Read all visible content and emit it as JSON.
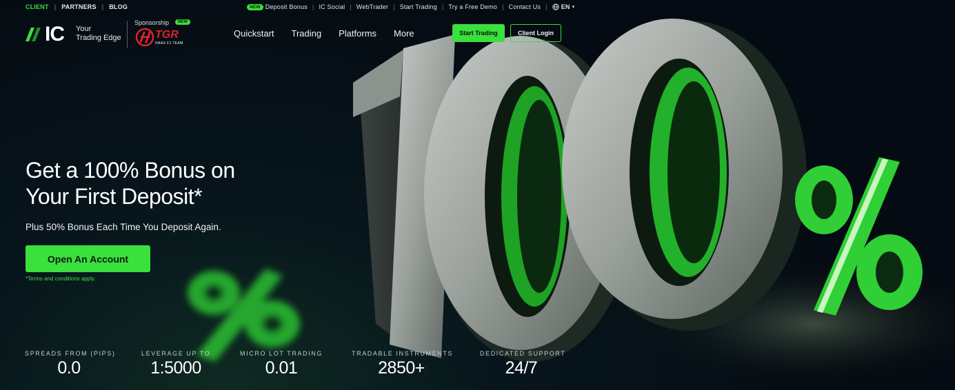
{
  "topbar": {
    "left_links": [
      {
        "label": "CLIENT",
        "active": true
      },
      {
        "label": "PARTNERS",
        "active": false
      },
      {
        "label": "BLOG",
        "active": false
      }
    ],
    "right_badge": "NEW",
    "right_links": [
      "Deposit Bonus",
      "IC Social",
      "WebTrader",
      "Start Trading",
      "Try a Free Demo",
      "Contact Us"
    ],
    "language": "EN"
  },
  "header": {
    "logo_text": "IC",
    "tagline_line1": "Your",
    "tagline_line2": "Trading Edge",
    "sponsorship_label": "Sponsorship",
    "sponsorship_badge": "NEW",
    "sponsor_logo_text": "TGR",
    "sponsor_logo_sub": "HAAS F1 TEAM",
    "nav": [
      "Quickstart",
      "Trading",
      "Platforms",
      "More"
    ],
    "start_trading": "Start Trading",
    "client_login": "Client Login"
  },
  "hero": {
    "title_line1": "Get a 100% Bonus on",
    "title_line2": "Your First Deposit*",
    "subtitle": "Plus 50% Bonus Each Time You Deposit Again.",
    "cta": "Open An Account",
    "terms": "*Terms and conditions apply.",
    "art_text": "100%"
  },
  "stats": [
    {
      "label": "SPREADS FROM (PIPS)",
      "value": "0.0"
    },
    {
      "label": "LEVERAGE UP TO",
      "value": "1:5000"
    },
    {
      "label": "MICRO LOT TRADING",
      "value": "0.01"
    },
    {
      "label": "TRADABLE INSTRUMENTS",
      "value": "2850+"
    },
    {
      "label": "DEDICATED SUPPORT",
      "value": "24/7"
    }
  ],
  "colors": {
    "accent": "#3ae03d",
    "background": "#07151c",
    "sponsor_red": "#e0212b"
  }
}
